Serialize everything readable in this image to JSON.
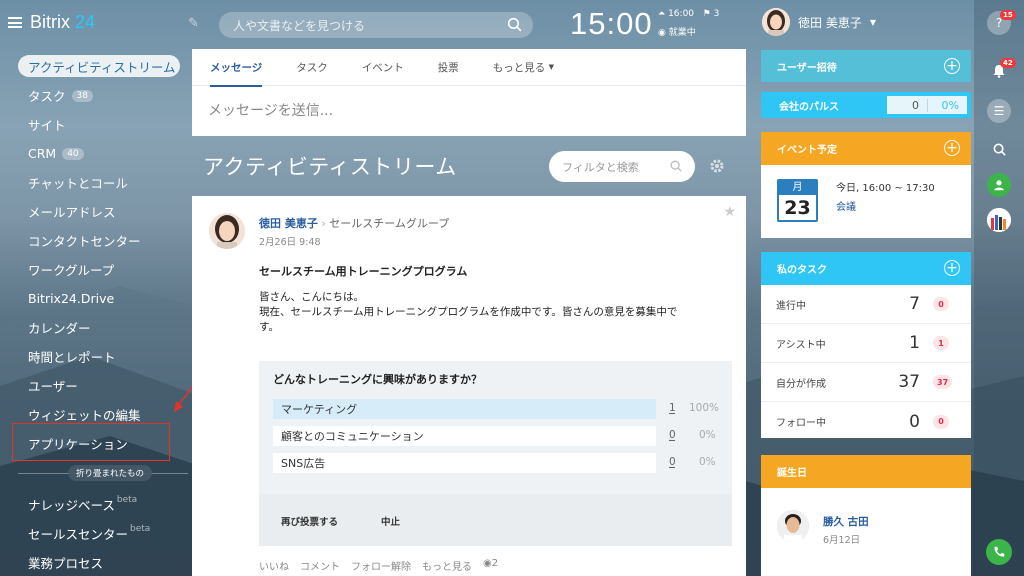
{
  "app": {
    "logo_main": "Bitrix",
    "logo_num": "24"
  },
  "sidebar": {
    "items": [
      {
        "label": "アクティビティストリーム",
        "count": ""
      },
      {
        "label": "タスク",
        "count": "38"
      },
      {
        "label": "サイト",
        "count": ""
      },
      {
        "label": "CRM",
        "count": "40"
      },
      {
        "label": "チャットとコール",
        "count": ""
      },
      {
        "label": "メールアドレス",
        "count": ""
      },
      {
        "label": "コンタクトセンター",
        "count": ""
      },
      {
        "label": "ワークグループ",
        "count": ""
      },
      {
        "label": "Bitrix24.Drive",
        "count": ""
      },
      {
        "label": "カレンダー",
        "count": ""
      },
      {
        "label": "時間とレポート",
        "count": ""
      },
      {
        "label": "ユーザー",
        "count": ""
      },
      {
        "label": "ウィジェットの編集",
        "count": ""
      },
      {
        "label": "アプリケーション",
        "count": ""
      }
    ],
    "collapsed_label": "折り畳まれたもの",
    "collapsed_items": [
      {
        "label": "ナレッジベース",
        "sup": "beta"
      },
      {
        "label": "セールスセンター",
        "sup": "beta"
      },
      {
        "label": "業務プロセス",
        "sup": ""
      }
    ]
  },
  "header": {
    "search_placeholder": "人や文書などを見つける",
    "clock": "15:00",
    "alarm_time": "16:00",
    "flag_count": "3",
    "work_status": "就業中",
    "user_name": "徳田 美恵子"
  },
  "compose": {
    "tabs": [
      "メッセージ",
      "タスク",
      "イベント",
      "投票",
      "もっと見る"
    ],
    "placeholder": "メッセージを送信..."
  },
  "stream": {
    "title": "アクティビティストリーム",
    "filter_placeholder": "フィルタと検索"
  },
  "post": {
    "author": "徳田 美恵子",
    "group": "セールスチームグループ",
    "date": "2月26日 9:48",
    "title": "セールスチーム用トレーニングプログラム",
    "body_line1": "皆さん、こんにちは。",
    "body_line2": "現在、セールスチーム用トレーニングプログラムを作成中です。皆さんの意見を募集中で",
    "body_line3": "す。",
    "poll": {
      "question": "どんなトレーニングに興味がありますか？",
      "options": [
        {
          "label": "マーケティング",
          "votes": "1",
          "percent": "100%"
        },
        {
          "label": "顧客とのコミュニケーション",
          "votes": "0",
          "percent": "0%"
        },
        {
          "label": "SNS広告",
          "votes": "0",
          "percent": "0%"
        }
      ],
      "revote": "再び投票する",
      "stop": "中止"
    },
    "actions": [
      "いいね",
      "コメント",
      "フォロー解除",
      "もっと見る"
    ],
    "views": "2"
  },
  "right": {
    "invite": "ユーザー招待",
    "pulse_label": "会社のパルス",
    "pulse_value": "0",
    "pulse_percent": "0%",
    "events_title": "イベント予定",
    "event": {
      "month": "月",
      "day": "23",
      "time": "今日, 16:00 ~ 17:30",
      "name": "会議"
    },
    "tasks_title": "私のタスク",
    "tasks": [
      {
        "label": "進行中",
        "value": "7",
        "badge": "0"
      },
      {
        "label": "アシスト中",
        "value": "1",
        "badge": "1"
      },
      {
        "label": "自分が作成",
        "value": "37",
        "badge": "37"
      },
      {
        "label": "フォロー中",
        "value": "0",
        "badge": "0"
      }
    ],
    "bday_title": "誕生日",
    "bday": {
      "name": "勝久 古田",
      "date": "6月12日"
    }
  },
  "rbar": {
    "help_badge": "15",
    "notif_badge": "42"
  },
  "colors": {
    "accent": "#2fc6f6",
    "orange": "#f5a623",
    "link": "#2b5d9e",
    "highlight": "#e2342b"
  }
}
